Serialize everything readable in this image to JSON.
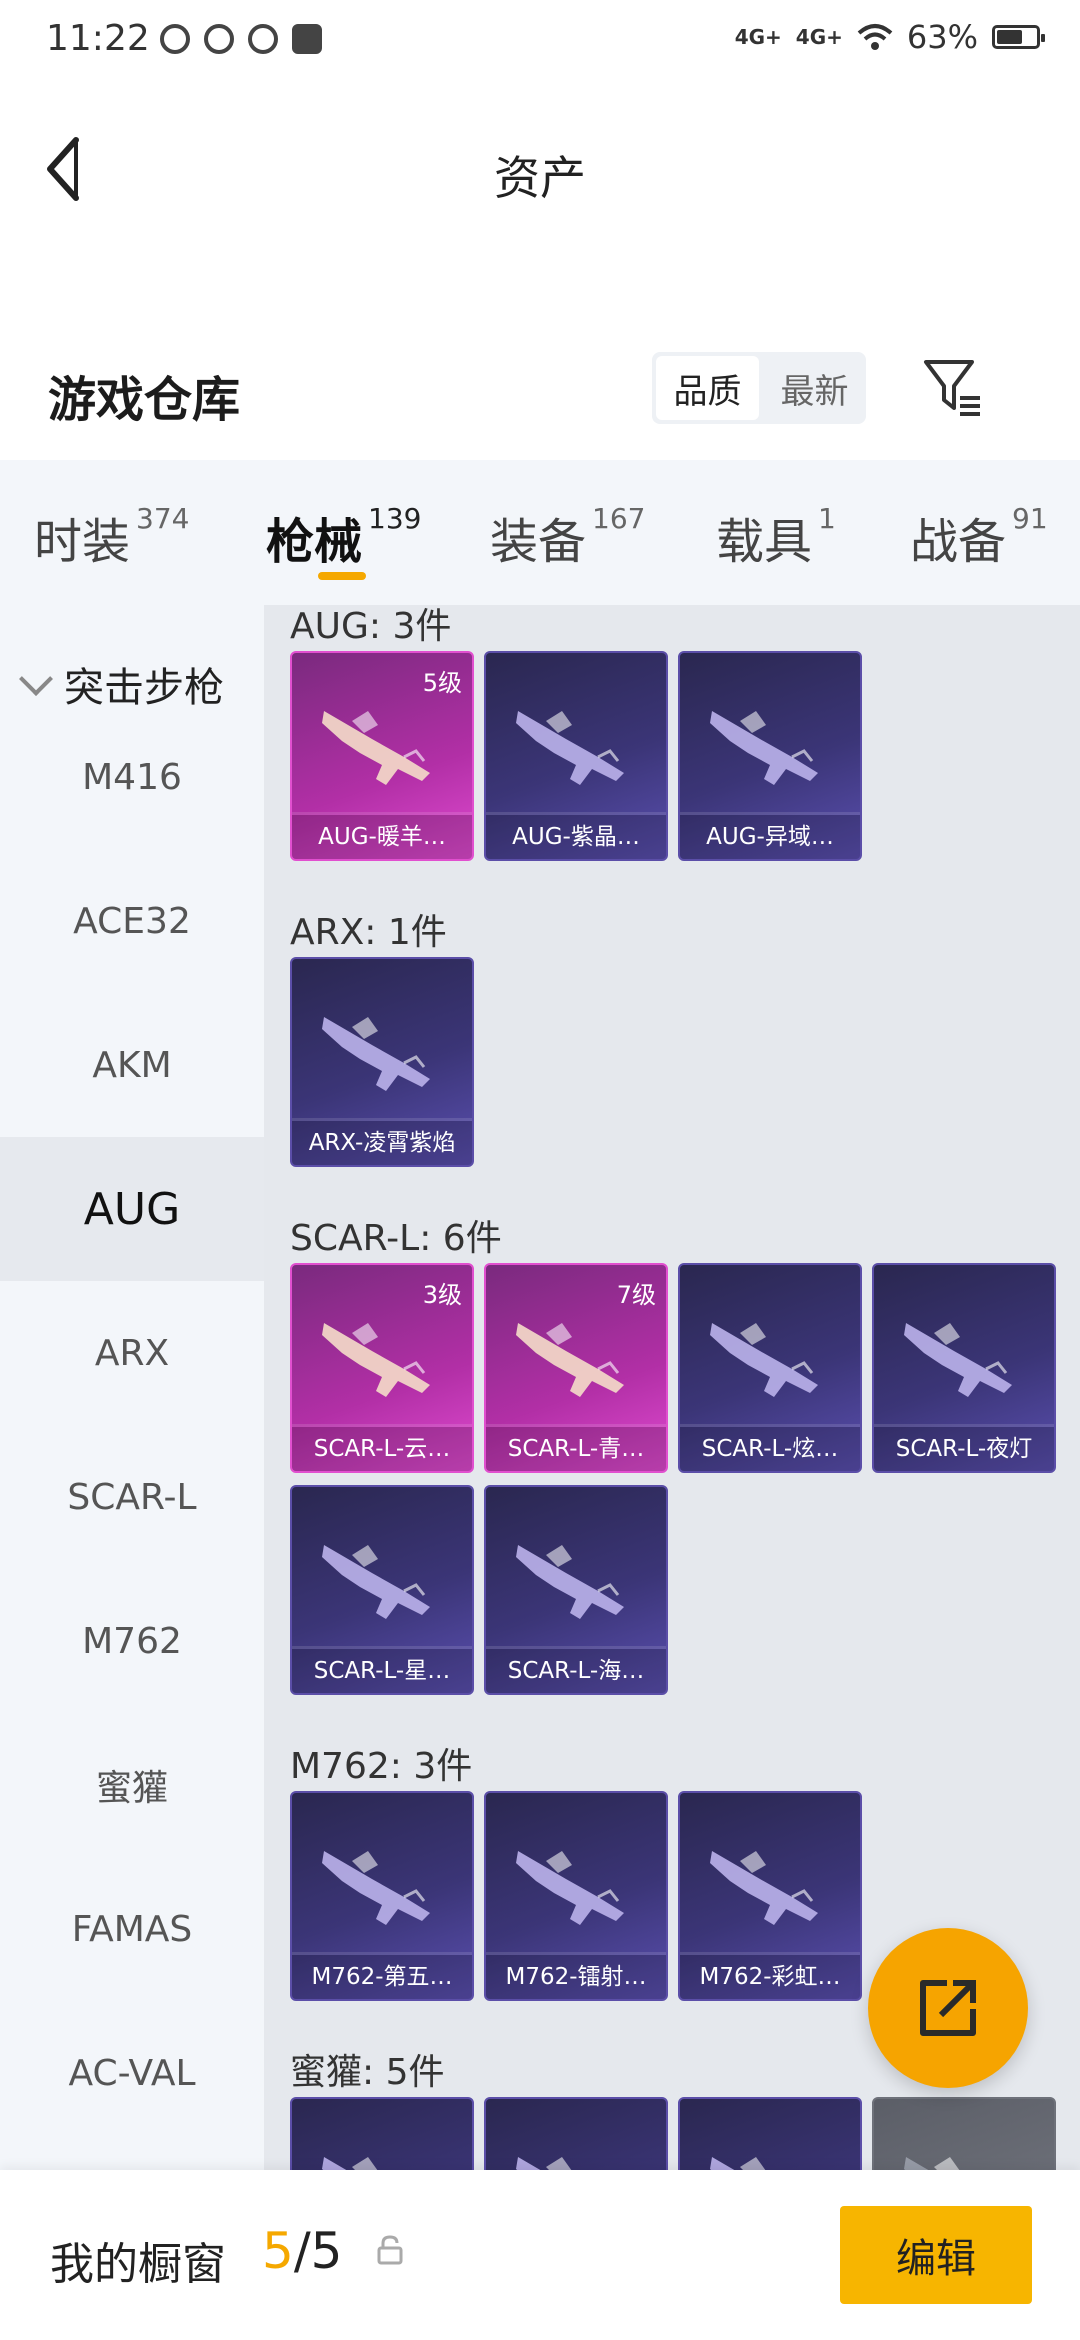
{
  "status_bar": {
    "time": "11:22",
    "signal_1": "4G+",
    "signal_2": "4G+",
    "battery": "63%",
    "battery_level": 0.63
  },
  "header": {
    "title": "资产"
  },
  "warehouse": {
    "title": "游戏仓库",
    "sort_options": [
      "品质",
      "最新"
    ],
    "sort_selected": "品质"
  },
  "tabs": [
    {
      "label": "时装",
      "count": "374"
    },
    {
      "label": "枪械",
      "count": "139"
    },
    {
      "label": "装备",
      "count": "167"
    },
    {
      "label": "载具",
      "count": "1"
    },
    {
      "label": "战备",
      "count": "91"
    }
  ],
  "sidebar": {
    "group": "突击步枪",
    "items": [
      "M416",
      "ACE32",
      "AKM",
      "AUG",
      "ARX",
      "SCAR-L",
      "M762",
      "蜜獾",
      "FAMAS",
      "AC-VAL"
    ],
    "selected": "AUG"
  },
  "sections": [
    {
      "title": "AUG: 3件",
      "items": [
        {
          "label": "AUG-暖羊…",
          "level": "5级",
          "rarity": "pink"
        },
        {
          "label": "AUG-紫晶…",
          "level": "",
          "rarity": "blue"
        },
        {
          "label": "AUG-异域…",
          "level": "",
          "rarity": "blue"
        }
      ]
    },
    {
      "title": "ARX: 1件",
      "items": [
        {
          "label": "ARX-凌霄紫焰",
          "level": "",
          "rarity": "blue"
        }
      ]
    },
    {
      "title": "SCAR-L: 6件",
      "items": [
        {
          "label": "SCAR-L-云…",
          "level": "3级",
          "rarity": "pink"
        },
        {
          "label": "SCAR-L-青…",
          "level": "7级",
          "rarity": "pink"
        },
        {
          "label": "SCAR-L-炫…",
          "level": "",
          "rarity": "blue"
        },
        {
          "label": "SCAR-L-夜灯",
          "level": "",
          "rarity": "blue"
        },
        {
          "label": "SCAR-L-星…",
          "level": "",
          "rarity": "blue"
        },
        {
          "label": "SCAR-L-海…",
          "level": "",
          "rarity": "blue"
        }
      ]
    },
    {
      "title": "M762: 3件",
      "items": [
        {
          "label": "M762-第五…",
          "level": "",
          "rarity": "blue"
        },
        {
          "label": "M762-镭射…",
          "level": "",
          "rarity": "blue"
        },
        {
          "label": "M762-彩虹…",
          "level": "",
          "rarity": "blue"
        }
      ]
    },
    {
      "title": "蜜獾: 5件",
      "items": [
        {
          "label": "",
          "level": "",
          "rarity": "blue"
        },
        {
          "label": "",
          "level": "",
          "rarity": "blue"
        },
        {
          "label": "",
          "level": "",
          "rarity": "blue"
        },
        {
          "label": "",
          "level": "",
          "rarity": "grey"
        }
      ]
    }
  ],
  "bottom_bar": {
    "showcase_label": "我的橱窗",
    "current": "5",
    "separator": "/",
    "total": "5",
    "edit_label": "编辑"
  },
  "colors": {
    "accent": "#f5a800",
    "tab_bg": "#f3f6fa",
    "content_bg": "#e5e8ed",
    "pink_card": "#b22fa6",
    "blue_card": "#3b3577"
  },
  "icons": {
    "back": "back-arrow-icon",
    "filter": "filter-icon",
    "share": "share-icon",
    "lock": "lock-icon"
  }
}
